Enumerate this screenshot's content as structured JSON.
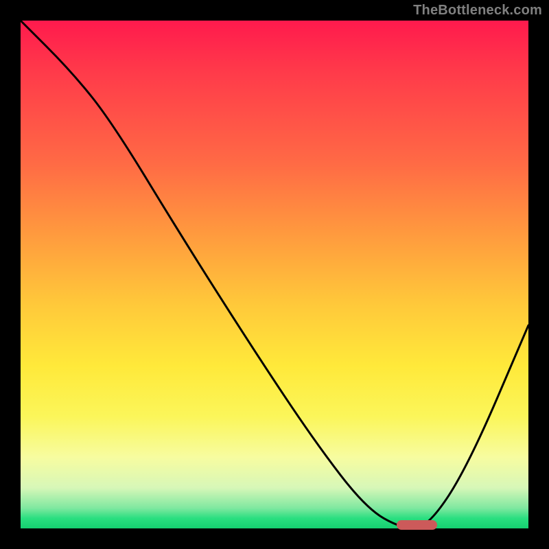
{
  "watermark": "TheBottleneck.com",
  "chart_data": {
    "type": "line",
    "title": "",
    "xlabel": "",
    "ylabel": "",
    "xlim": [
      0,
      100
    ],
    "ylim": [
      0,
      100
    ],
    "series": [
      {
        "name": "bottleneck-curve",
        "x": [
          0,
          10,
          18,
          32,
          46,
          58,
          68,
          75,
          80,
          88,
          100
        ],
        "values": [
          100,
          90,
          80,
          57,
          35,
          17,
          4,
          0,
          0,
          12,
          40
        ]
      }
    ],
    "marker": {
      "x_start": 74,
      "x_end": 82,
      "y": 0
    },
    "gradient_stops": [
      {
        "pos": 0,
        "color": "#ff1a4d"
      },
      {
        "pos": 28,
        "color": "#ff6a45"
      },
      {
        "pos": 56,
        "color": "#ffc93a"
      },
      {
        "pos": 78,
        "color": "#fbf65a"
      },
      {
        "pos": 92,
        "color": "#d7f7b8"
      },
      {
        "pos": 100,
        "color": "#15d070"
      }
    ]
  }
}
